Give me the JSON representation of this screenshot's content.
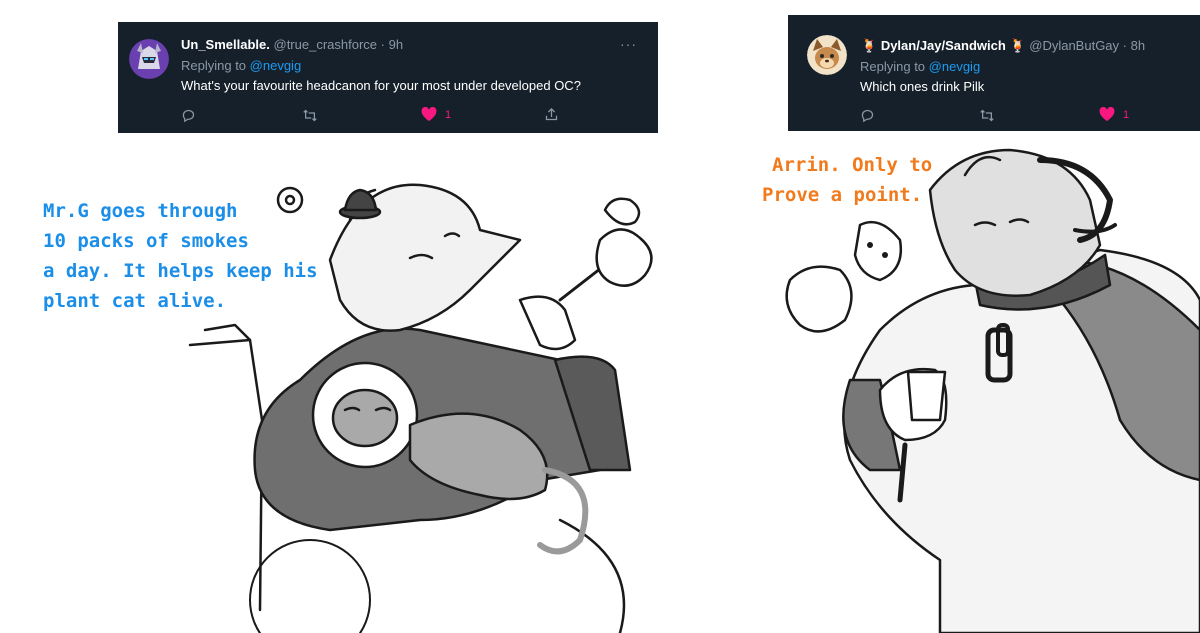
{
  "tweet1": {
    "display_name": "Un_Smellable.",
    "handle": "@true_crashforce",
    "time": "· 9h",
    "replying_prefix": "Replying to",
    "replying_to": "@nevgig",
    "text": "What's your favourite headcanon for your most under developed OC?",
    "more_label": "···",
    "like_count": "1",
    "avatar_icon": "robot-helmet-avatar"
  },
  "tweet2": {
    "display_name": "Dylan/Jay/Sandwich",
    "name_emoji_left": "🍹",
    "name_emoji_right": "🍹",
    "handle": "@DylanButGay",
    "time": "· 8h",
    "replying_prefix": "Replying to",
    "replying_to": "@nevgig",
    "text": "Which ones drink Pilk",
    "like_count": "1",
    "avatar_icon": "furry-character-avatar"
  },
  "captions": {
    "left_lines": [
      "Mr.G goes through",
      "10 packs of smokes",
      "a day. It helps keep his",
      "plant cat alive."
    ],
    "right_lines": [
      "Arrin. Only to",
      "Prove a point."
    ],
    "left_color": "#1b8ee8",
    "right_color": "#f07a1c"
  },
  "colors": {
    "tweet_bg": "#15202b",
    "muted": "#8b98a5",
    "link": "#1d9bf0",
    "like": "#f91880"
  }
}
